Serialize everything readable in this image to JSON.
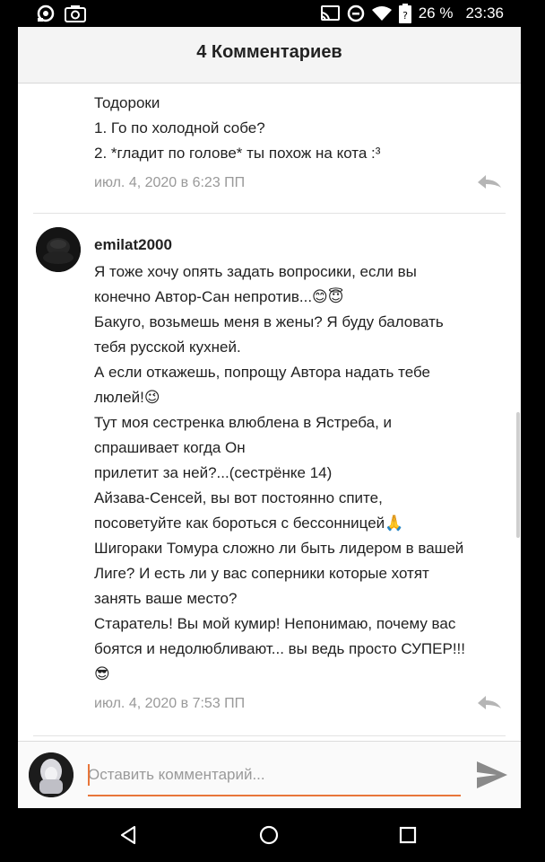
{
  "status_bar": {
    "battery": "26 %",
    "time": "23:36"
  },
  "header": {
    "title": "4 Комментариев"
  },
  "comments": [
    {
      "lines": [
        "Тодороки",
        "1. Го по холодной собе?",
        "2. *гладит по голове* ты похож на кота :³"
      ],
      "date": "июл. 4, 2020 в 6:23 ПП"
    },
    {
      "author": "emilat2000",
      "lines": [
        "Я тоже хочу опять задать вопросики, если вы",
        "конечно Автор-Сан непротив...😊😇",
        "Бакуго, возьмешь меня в жены? Я буду баловать",
        "тебя русской кухней.",
        "А если откажешь, попрощу Автора надать тебе",
        "люлей!😉",
        "Тут моя сестренка влюблена в Ястреба, и",
        "спрашивает когда Он",
        "прилетит за ней?...(сестрёнке 14)",
        "Айзава-Сенсей, вы вот постоянно спите,",
        "посоветуйте как бороться с бессонницей🙏",
        "Шигораки Томура сложно ли быть лидером в вашей",
        "Лиге? И есть ли у вас соперники которые хотят",
        "занять ваше место?",
        "Старатель! Вы мой кумир! Непонимаю, почему вас",
        "боятся и недолюбливают... вы ведь просто СУПЕР!!!",
        "😎"
      ],
      "date": "июл. 4, 2020 в 7:53 ПП"
    }
  ],
  "comment_input": {
    "placeholder": "Оставить комментарий..."
  },
  "colors": {
    "accent": "#e8763a",
    "meta_text": "#999999"
  }
}
